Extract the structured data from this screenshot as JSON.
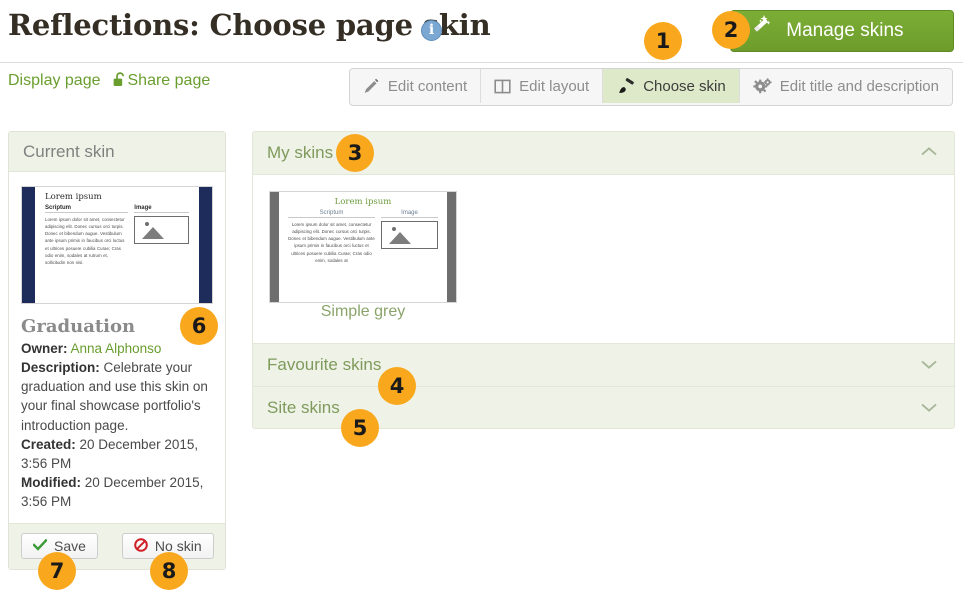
{
  "header": {
    "title": "Reflections: Choose page skin",
    "info_icon": "info-icon",
    "info_char": "i",
    "manage_skins_label": "Manage skins",
    "manage_skins_icon": "magic-wand-icon",
    "accent_green": "#76a732",
    "badge_orange": "#f9a81d"
  },
  "subnav": {
    "display_page": "Display page",
    "share_page": "Share page",
    "share_icon": "open-lock-icon",
    "tabs": [
      {
        "label": "Edit content",
        "icon": "pencil-icon",
        "active": false
      },
      {
        "label": "Edit layout",
        "icon": "columns-icon",
        "active": false
      },
      {
        "label": "Choose skin",
        "icon": "paintbrush-icon",
        "active": true
      },
      {
        "label": "Edit title and description",
        "icon": "gears-icon",
        "active": false
      }
    ]
  },
  "current_skin": {
    "panel_heading": "Current skin",
    "thumbnail": {
      "title": "Lorem ipsum",
      "column_left_heading": "Scriptum",
      "column_right_heading": "Image",
      "body_text": "Lorem ipsum dolor sit amet, consectetur adipiscing elit. Donec cursus orci turpis. Donec et bibendum augue. Vestibulum ante ipsum primis in faucibus orci luctus et ultrices posuere cubilia Curae; Cras odio enim, sodales at rutrum et, sollicitudin non nisi.",
      "sidebar_color": "#1e2c5c",
      "image_icon": "picture-placeholder-icon"
    },
    "name": "Graduation",
    "owner_label": "Owner:",
    "owner_value": "Anna Alphonso",
    "description_label": "Description:",
    "description_value": "Celebrate your graduation and use this skin on your final showcase portfolio's introduction page.",
    "created_label": "Created:",
    "created_value": "20 December 2015, 3:56 PM",
    "modified_label": "Modified:",
    "modified_value": "20 December 2015, 3:56 PM",
    "save_label": "Save",
    "save_icon": "check-icon",
    "no_skin_label": "No skin",
    "no_skin_icon": "ban-icon"
  },
  "accordion": {
    "my_skins": {
      "label": "My skins",
      "expanded": true,
      "chevron": "chevron-up-icon",
      "skins": [
        {
          "name": "Simple grey",
          "thumbnail": {
            "title": "Lorem ipsum",
            "column_left_heading": "Scriptum",
            "column_right_heading": "Image",
            "body_text": "Lorem ipsum dolor sit amet, consectetur adipiscing elit. Donec cursus orci turpis. Donec et bibendum augue. Vestibulum ante ipsum primis in faucibus orci luctus et ultrices posuere cubilia Curae; Cras odio enim, sodales at",
            "sidebar_color": "#6e6e6e",
            "image_icon": "picture-placeholder-icon"
          }
        }
      ]
    },
    "favourite_skins": {
      "label": "Favourite skins",
      "expanded": false,
      "chevron": "chevron-down-icon"
    },
    "site_skins": {
      "label": "Site skins",
      "expanded": false,
      "chevron": "chevron-down-icon"
    }
  },
  "callouts": {
    "one": "1",
    "two": "2",
    "three": "3",
    "four": "4",
    "five": "5",
    "six": "6",
    "seven": "7",
    "eight": "8"
  }
}
